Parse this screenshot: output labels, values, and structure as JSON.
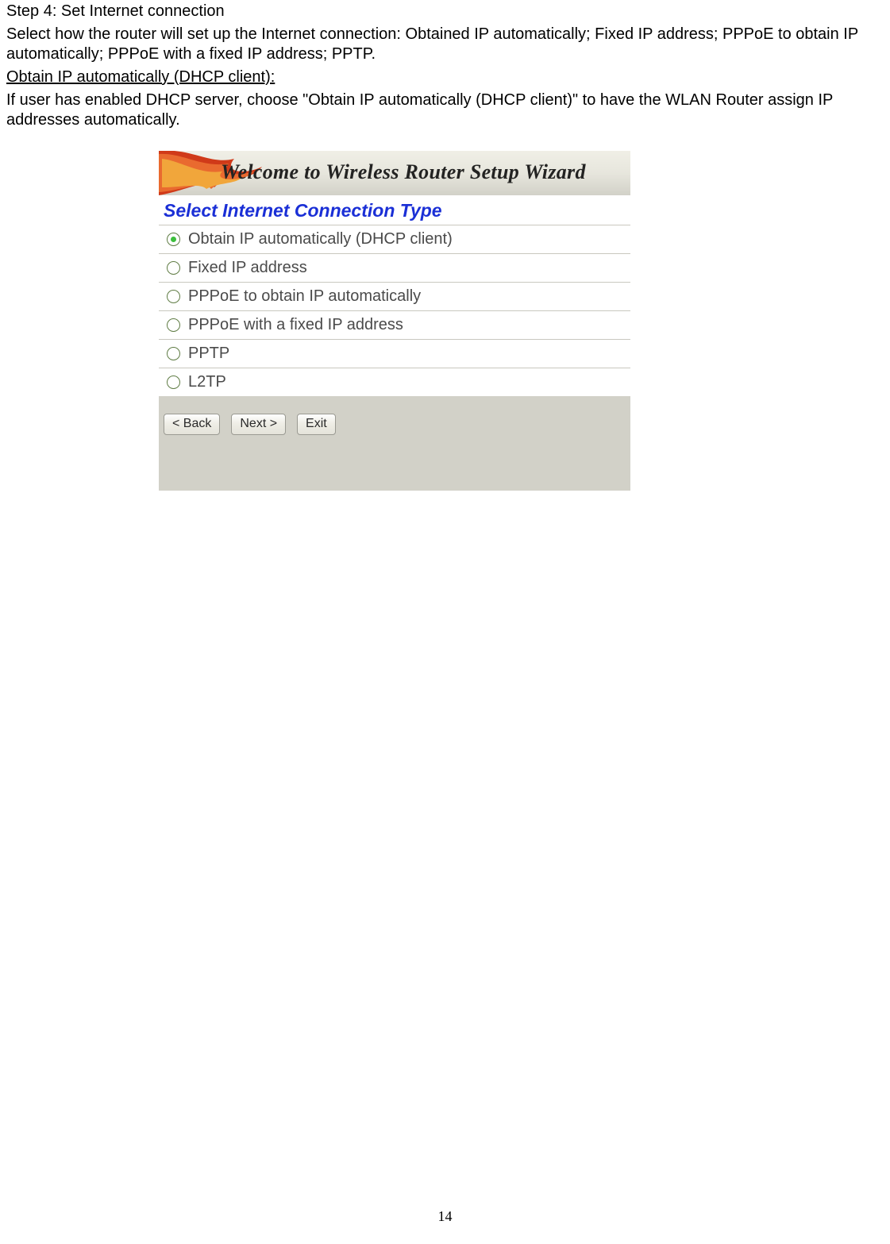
{
  "doc": {
    "step_line": "Step 4: Set Internet connection",
    "para1": "Select how the router will set up the Internet connection: Obtained IP automatically; Fixed IP address; PPPoE to obtain IP automatically; PPPoE with a fixed IP address; PPTP.",
    "subhead": "Obtain IP automatically (DHCP client):",
    "para2": "If user has enabled DHCP server, choose \"Obtain IP automatically (DHCP client)\" to have the WLAN Router assign IP addresses automatically."
  },
  "wizard": {
    "banner_text": "Welcome to Wireless Router Setup Wizard",
    "heading": "Select Internet Connection Type",
    "options": [
      {
        "label": "Obtain IP automatically (DHCP client)",
        "selected": true
      },
      {
        "label": "Fixed IP address",
        "selected": false
      },
      {
        "label": "PPPoE to obtain IP automatically",
        "selected": false
      },
      {
        "label": "PPPoE with a fixed IP address",
        "selected": false
      },
      {
        "label": "PPTP",
        "selected": false
      },
      {
        "label": "L2TP",
        "selected": false
      }
    ],
    "buttons": {
      "back": "< Back",
      "next": "Next >",
      "exit": "Exit"
    }
  },
  "page_number": "14"
}
